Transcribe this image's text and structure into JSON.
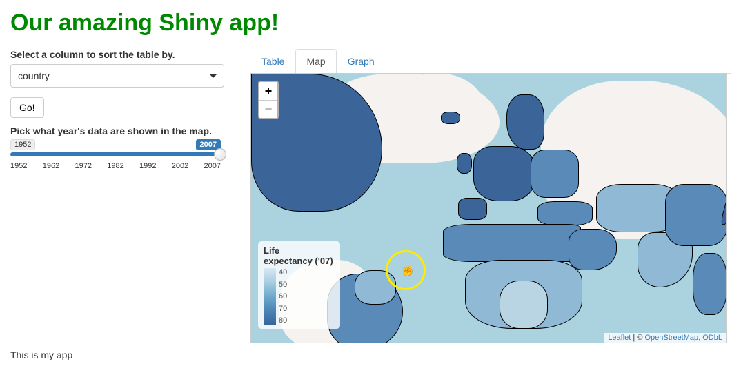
{
  "title": "Our amazing Shiny app!",
  "sidebar": {
    "sort_label": "Select a column to sort the table by.",
    "sort_selected": "country",
    "go_button": "Go!",
    "year_label": "Pick what year's data are shown in the map.",
    "slider_min": "1952",
    "slider_max": "2007",
    "slider_ticks": [
      "1952",
      "1962",
      "1972",
      "1982",
      "1992",
      "2002",
      "2007"
    ]
  },
  "tabs": {
    "table": "Table",
    "map": "Map",
    "graph": "Graph",
    "active": "Map"
  },
  "map": {
    "zoom_in": "+",
    "zoom_out": "−",
    "legend_title_a": "Life",
    "legend_title_b": "expectancy ('07)",
    "legend_ticks": [
      "40",
      "50",
      "60",
      "70",
      "80"
    ],
    "attribution_leaflet": "Leaflet",
    "attribution_sep": " | © ",
    "attribution_osm": "OpenStreetMap, ODbL"
  },
  "footer": "This is my app"
}
